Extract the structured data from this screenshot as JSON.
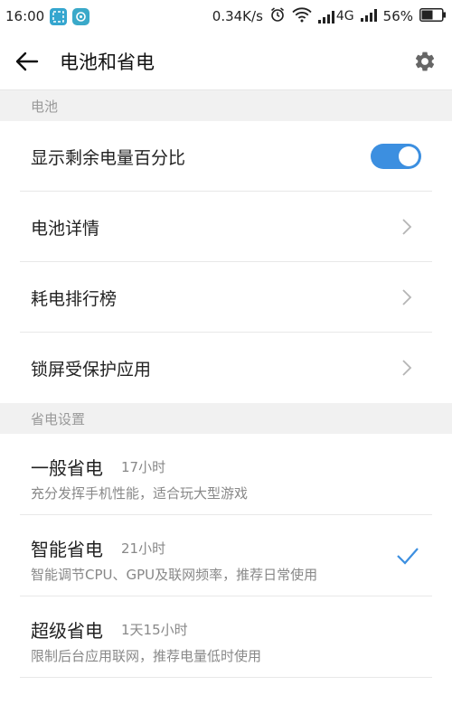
{
  "status_bar": {
    "time": "16:00",
    "speed": "0.34K/s",
    "network": "4G",
    "battery_percent": "56%",
    "battery_level": 0.56
  },
  "app_bar": {
    "title": "电池和省电"
  },
  "sections": {
    "battery_header": "电池",
    "saving_header": "省电设置"
  },
  "battery_items": [
    {
      "label": "显示剩余电量百分比",
      "toggle_on": true
    },
    {
      "label": "电池详情"
    },
    {
      "label": "耗电排行榜"
    },
    {
      "label": "锁屏受保护应用"
    }
  ],
  "power_modes": [
    {
      "title": "一般省电",
      "duration": "17小时",
      "desc": "充分发挥手机性能，适合玩大型游戏",
      "selected": false
    },
    {
      "title": "智能省电",
      "duration": "21小时",
      "desc": "智能调节CPU、GPU及联网频率，推荐日常使用",
      "selected": true
    },
    {
      "title": "超级省电",
      "duration": "1天15小时",
      "desc": "限制后台应用联网，推荐电量低时使用",
      "selected": false
    }
  ],
  "colors": {
    "accent": "#3c8fe0",
    "section_bg": "#f1f1f1",
    "secondary_text": "#888888"
  }
}
